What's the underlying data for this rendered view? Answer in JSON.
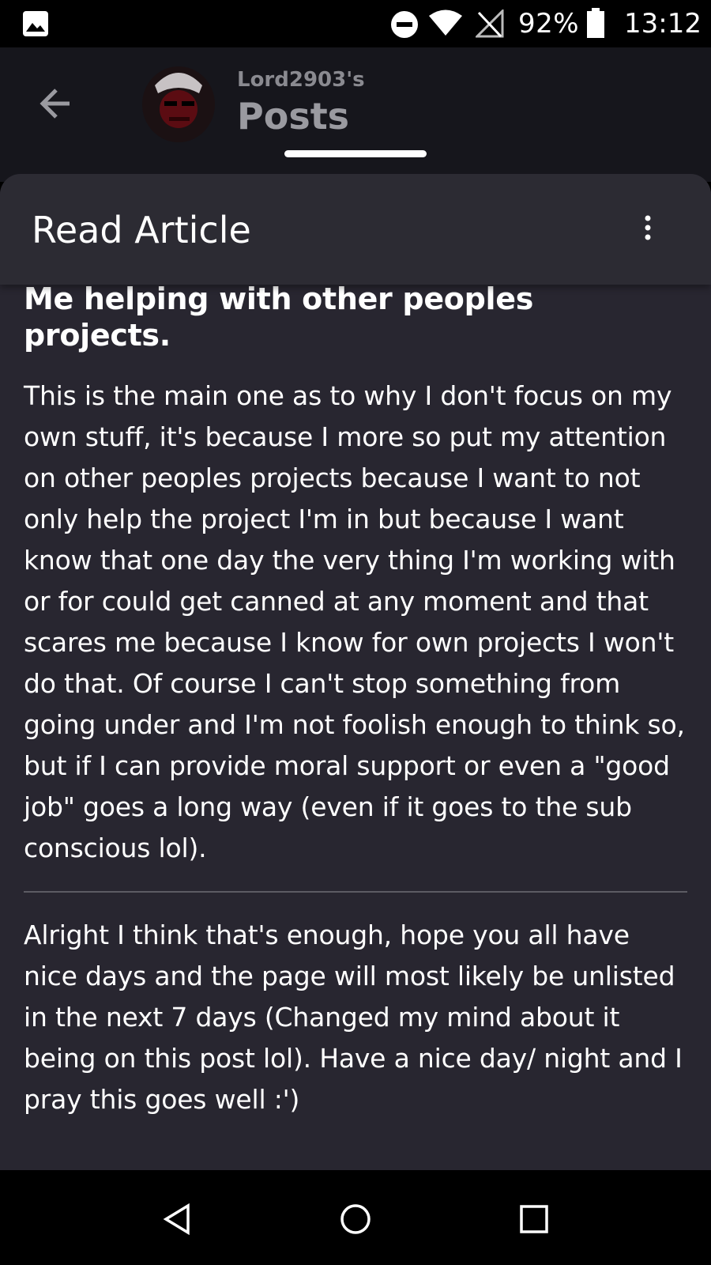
{
  "status_bar": {
    "battery_percent": "92%",
    "time": "13:12",
    "icons": [
      "gallery-icon",
      "do-not-disturb-icon",
      "wifi-icon",
      "no-signal-icon",
      "battery-icon"
    ]
  },
  "header": {
    "owner": "Lord2903's",
    "title": "Posts",
    "back_icon": "arrow-left-icon"
  },
  "sheet": {
    "title": "Read Article",
    "menu_icon": "more-vertical-icon"
  },
  "article": {
    "heading": "Me helping with other peoples projects.",
    "paragraph1": "This is the main one as to why I don't focus on my own stuff, it's because I more so put my attention on other peoples projects because I want to not only help the project I'm in but because I want know that one day the very thing I'm working with or for could get canned at any moment and that scares me because I know for own projects I won't do that. Of course I can't stop something from going under and I'm not foolish enough to think so, but if I can provide moral support or even a \"good job\" goes a long way (even if it goes to the sub conscious lol).",
    "paragraph2": "Alright I think that's enough, hope you all have nice days and the page will most likely be unlisted in the next 7 days (Changed my mind about it being on this post lol). Have a nice day/ night and I pray this goes well :')"
  },
  "nav_bar": {
    "icons": [
      "nav-back-icon",
      "nav-home-icon",
      "nav-recents-icon"
    ]
  }
}
